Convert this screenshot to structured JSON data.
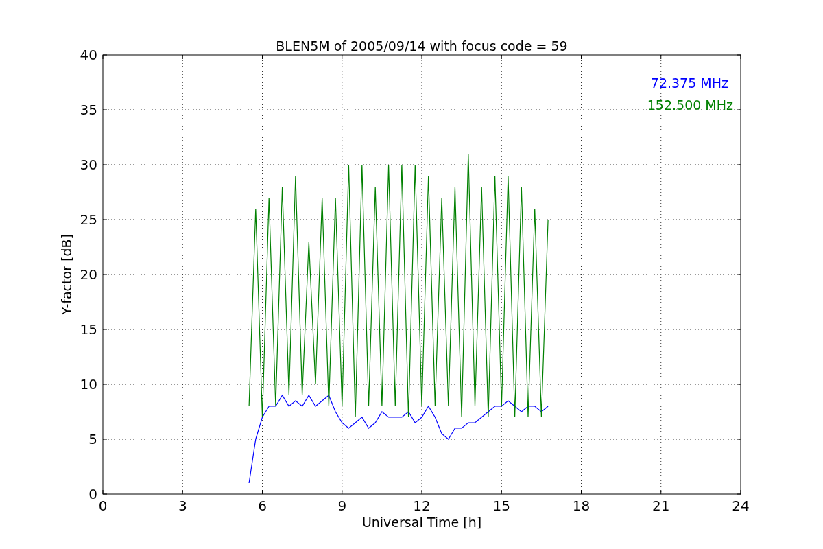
{
  "chart_data": {
    "type": "line",
    "grid": true,
    "title": "BLEN5M of 2005/09/14 with focus code = 59",
    "xlabel": "Universal Time [h]",
    "ylabel": "Y-factor [dB]",
    "xlim": [
      0,
      24
    ],
    "ylim": [
      0,
      40
    ],
    "xticks": [
      0,
      3,
      6,
      9,
      12,
      15,
      18,
      21,
      24
    ],
    "yticks": [
      0,
      5,
      10,
      15,
      20,
      25,
      30,
      35,
      40
    ],
    "x": [
      5.5,
      5.75,
      6,
      6.25,
      6.5,
      6.75,
      7,
      7.25,
      7.5,
      7.75,
      8,
      8.25,
      8.5,
      8.75,
      9,
      9.25,
      9.5,
      9.75,
      10,
      10.25,
      10.5,
      10.75,
      11,
      11.25,
      11.5,
      11.75,
      12,
      12.25,
      12.5,
      12.75,
      13,
      13.25,
      13.5,
      13.75,
      14,
      14.25,
      14.5,
      14.75,
      15,
      15.25,
      15.5,
      15.75,
      16,
      16.25,
      16.5,
      16.75
    ],
    "series": [
      {
        "name": "72.375 MHz",
        "color": "#0000ff",
        "values": [
          1,
          5,
          7,
          8,
          8,
          9,
          8,
          8.5,
          8,
          9,
          8,
          8.5,
          9,
          7.5,
          6.5,
          6,
          6.5,
          7,
          6,
          6.5,
          7.5,
          7,
          7,
          7,
          7.5,
          6.5,
          7,
          8,
          7,
          5.5,
          5,
          6,
          6,
          6.5,
          6.5,
          7,
          7.5,
          8,
          8,
          8.5,
          8,
          7.5,
          8,
          8,
          7.5,
          8
        ]
      },
      {
        "name": "152.500 MHz",
        "color": "#008000",
        "values": [
          8,
          26,
          7,
          27,
          8,
          28,
          9,
          29,
          9,
          23,
          10,
          27,
          8,
          27,
          8,
          30,
          7,
          30,
          8,
          28,
          8,
          30,
          8,
          30,
          7,
          30,
          8,
          29,
          8,
          27,
          8,
          28,
          7,
          31,
          8,
          28,
          7,
          29,
          8,
          29,
          7,
          28,
          7,
          26,
          7,
          25
        ]
      }
    ]
  }
}
